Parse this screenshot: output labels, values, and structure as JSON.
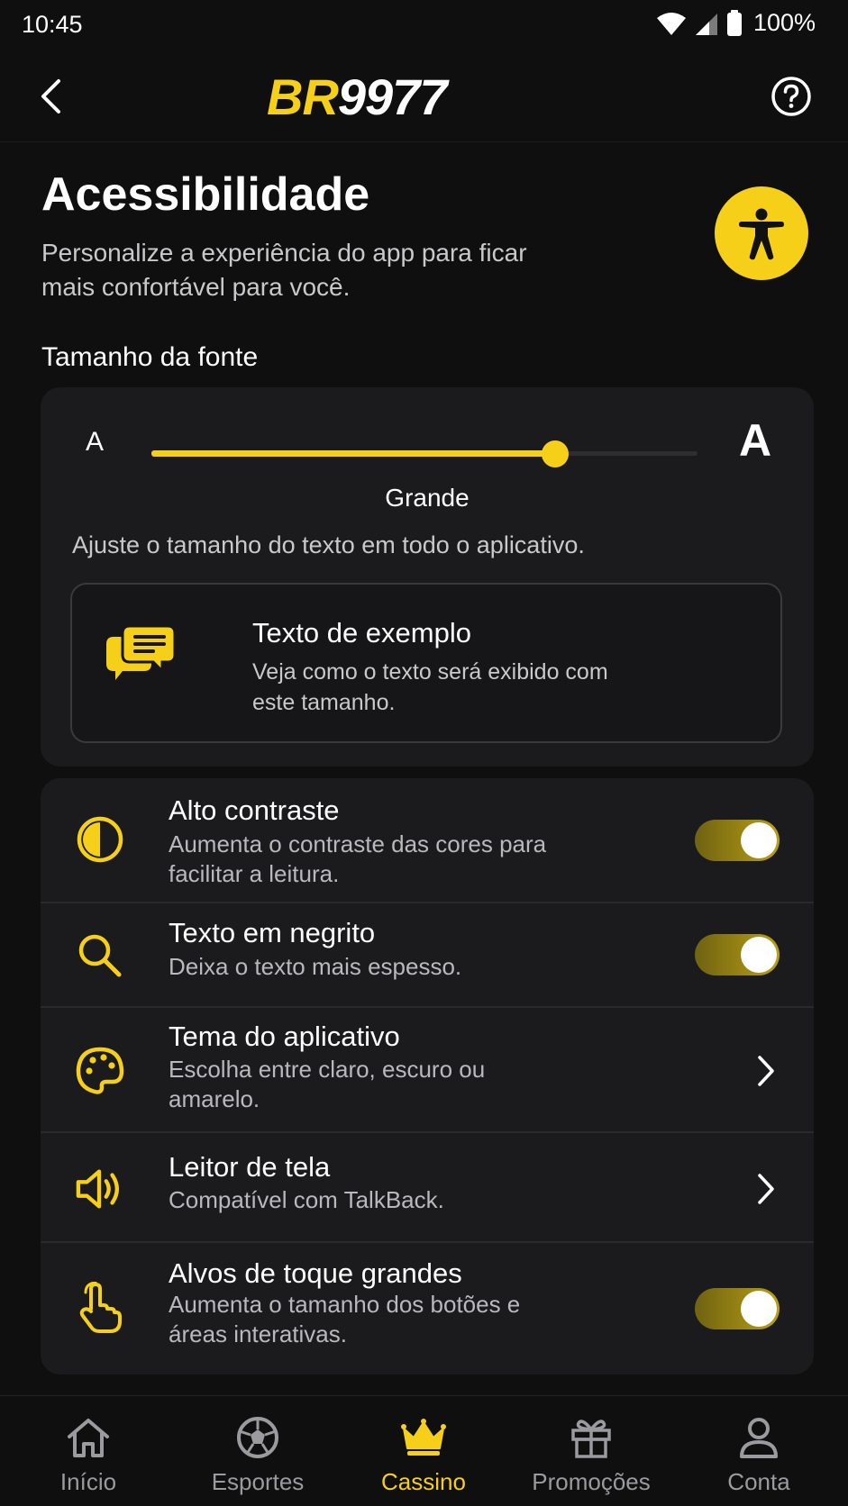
{
  "status_bar": {
    "time": "10:45",
    "battery": "100%"
  },
  "header": {
    "logo_prefix": "BR",
    "logo_suffix": "9977"
  },
  "page": {
    "title": "Acessibilidade",
    "subtitle": "Personalize a experiência do app para ficar mais confortável para você."
  },
  "font_size": {
    "section_label": "Tamanho da fonte",
    "small_glyph": "A",
    "large_glyph": "A",
    "level_fraction": 0.74,
    "value_label": "Grande",
    "help_text": "Ajuste o tamanho do texto em todo o aplicativo.",
    "sample_title": "Texto de exemplo",
    "sample_text": "Veja como o texto será exibido com este tamanho."
  },
  "settings": [
    {
      "title": "Alto contraste",
      "description": "Aumenta o contraste das cores para facilitar a leitura.",
      "icon": "contrast-icon",
      "control": "toggle",
      "on": true
    },
    {
      "title": "Texto em negrito",
      "description": "Deixa o texto mais espesso.",
      "icon": "magnifier-icon",
      "control": "toggle",
      "on": true
    },
    {
      "title": "Tema do aplicativo",
      "description": "Escolha entre claro, escuro ou amarelo.",
      "icon": "palette-icon",
      "control": "chevron"
    },
    {
      "title": "Leitor de tela",
      "description": "Compatível com TalkBack.",
      "icon": "speaker-icon",
      "control": "chevron"
    },
    {
      "title": "Alvos de toque grandes",
      "description": "Aumenta o tamanho dos botões e áreas interativas.",
      "icon": "touch-hand-icon",
      "control": "toggle",
      "on": true
    }
  ],
  "bottom_nav": [
    {
      "label": "Início",
      "icon": "home-icon",
      "active": false
    },
    {
      "label": "Esportes",
      "icon": "soccer-ball-icon",
      "active": false
    },
    {
      "label": "Cassino",
      "icon": "crown-icon",
      "active": true
    },
    {
      "label": "Promoções",
      "icon": "gift-icon",
      "active": false
    },
    {
      "label": "Conta",
      "icon": "user-icon",
      "active": false
    }
  ],
  "colors": {
    "accent": "#f5cf18",
    "background": "#0f0f10",
    "card": "#1b1b1d",
    "muted_text": "#c9c9cc",
    "nav_inactive": "#9a9a9f"
  }
}
